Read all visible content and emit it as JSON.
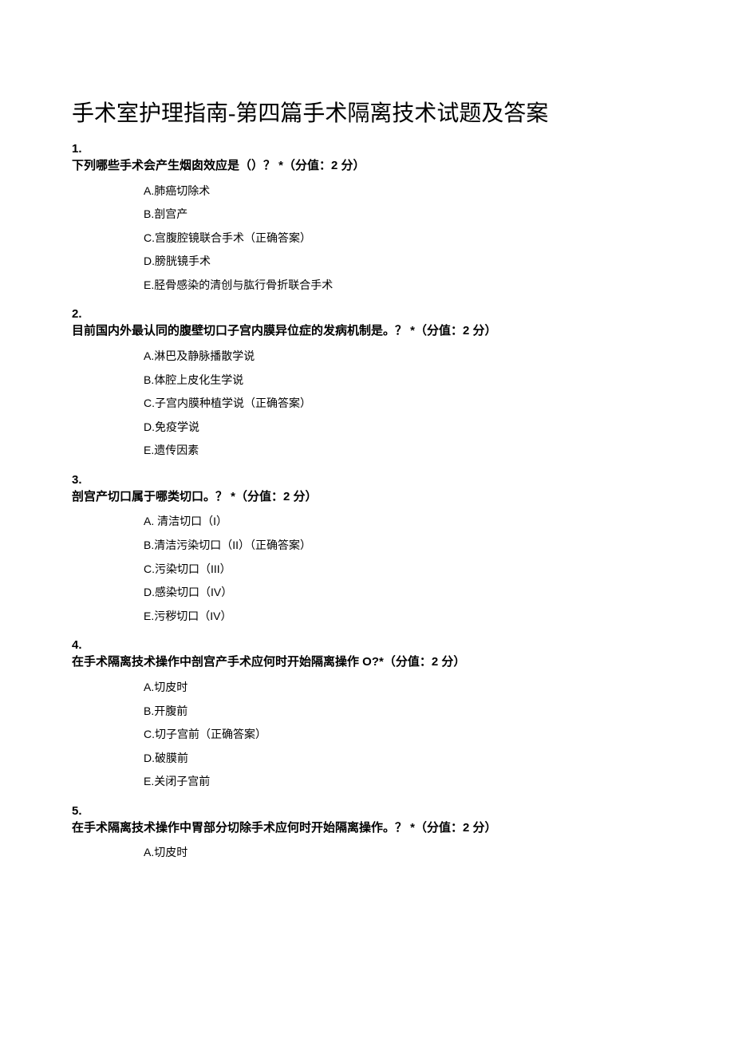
{
  "title": "手术室护理指南-第四篇手术隔离技术试题及答案",
  "questions": [
    {
      "num": "1.",
      "text": "下列哪些手术会产生烟囱效应是（）？ *（分值：2 分）",
      "options": [
        "A.肺癌切除术",
        "B.剖宫产",
        "C.宫腹腔镜联合手术（正确答案）",
        "D.膀胱镜手术",
        "E.胫骨感染的清创与肱行骨折联合手术"
      ]
    },
    {
      "num": "2.",
      "text": "目前国内外最认同的腹壁切口子宫内膜异位症的发病机制是。？ *（分值：2 分）",
      "options": [
        "A.淋巴及静脉播散学说",
        "B.体腔上皮化生学说",
        "C.子宫内膜种植学说（正确答案）",
        "D.免疫学说",
        "E.遗传因素"
      ]
    },
    {
      "num": "3.",
      "text": "剖宫产切口属于哪类切口。？ *（分值：2 分）",
      "options": [
        "A. 清洁切口（I）",
        "B.清洁污染切口（II）（正确答案）",
        "C.污染切口（III）",
        "D.感染切口（IV）",
        "E.污秽切口（IV）"
      ]
    },
    {
      "num": "4.",
      "text": "在手术隔离技术操作中剖宫产手术应何时开始隔离操作 O?*（分值：2 分）",
      "options": [
        "A.切皮时",
        "B.开腹前",
        "C.切子宫前（正确答案）",
        "D.破膜前",
        "E.关闭子宫前"
      ]
    },
    {
      "num": "5.",
      "text": "在手术隔离技术操作中胃部分切除手术应何时开始隔离操作。？ *（分值：2 分）",
      "options": [
        "A.切皮时"
      ]
    }
  ]
}
